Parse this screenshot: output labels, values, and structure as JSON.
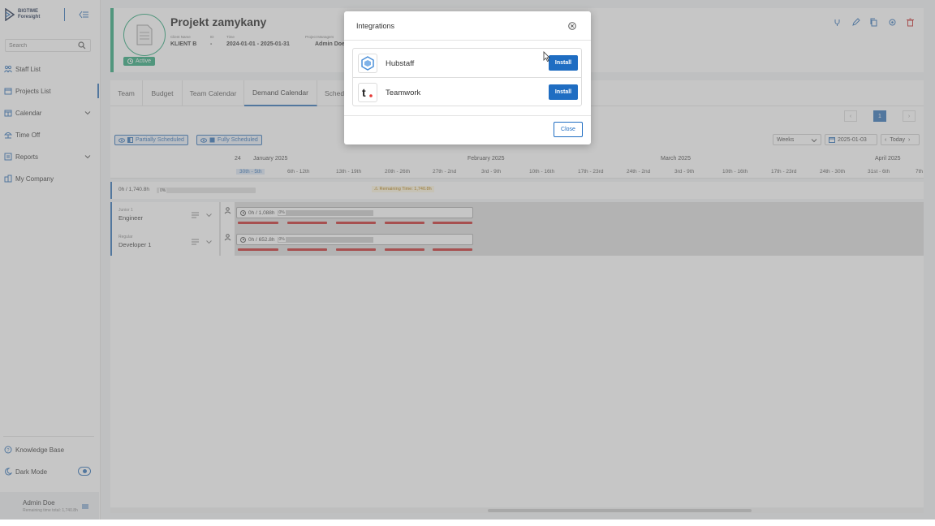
{
  "brand": {
    "line1": "BIGTIME",
    "line2": "Foresight"
  },
  "search": {
    "placeholder": "Search"
  },
  "nav": {
    "staff_list": "Staff List",
    "projects_list": "Projects List",
    "calendar": "Calendar",
    "time_off": "Time Off",
    "reports": "Reports",
    "my_company": "My Company",
    "knowledge_base": "Knowledge Base",
    "dark_mode": "Dark Mode"
  },
  "user": {
    "name": "Admin Doe",
    "subtitle": "Remaining time total: 1,740.8h"
  },
  "project": {
    "title": "Projekt zamykany",
    "status": "Active",
    "client_label": "Client Name",
    "client_value": "KLIENT B",
    "id_label": "ID",
    "id_value": "-",
    "time_label": "Time",
    "time_value": "2024-01-01 - 2025-01-31",
    "manager_label": "Project Managers",
    "manager_value": "Admin Doe"
  },
  "tabs": [
    "Team",
    "Budget",
    "Team Calendar",
    "Demand Calendar",
    "Sched"
  ],
  "pager": {
    "prev": "‹",
    "page": "1",
    "next": "›"
  },
  "filters": {
    "partially": "Partially Scheduled",
    "fully": "Fully Scheduled"
  },
  "controls": {
    "period": "Weeks",
    "date": "2025-01-03",
    "today": "Today"
  },
  "timeline": {
    "months": [
      "24",
      "January 2025",
      "February 2025",
      "March 2025",
      "April 2025"
    ],
    "weeks": [
      "30th - 5th",
      "6th - 12th",
      "13th - 19th",
      "20th - 26th",
      "27th - 2nd",
      "3rd - 9th",
      "10th - 16th",
      "17th - 23rd",
      "24th - 2nd",
      "3rd - 9th",
      "10th - 16th",
      "17th - 23rd",
      "24th - 30th",
      "31st - 6th",
      "7th"
    ]
  },
  "summary": {
    "hours": "0h / 1,740.8h",
    "pct": "0%",
    "warning": "Remaining Time: 1,740.8h"
  },
  "roles": [
    {
      "level": "Junior 1",
      "name": "Engineer",
      "alloc": "0h / 1,088h",
      "pct": "0%"
    },
    {
      "level": "Regular",
      "name": "Developer 1",
      "alloc": "0h / 652.8h",
      "pct": "0%"
    }
  ],
  "modal": {
    "title": "Integrations",
    "items": [
      {
        "name": "Hubstaff",
        "button": "Install"
      },
      {
        "name": "Teamwork",
        "button": "Install"
      }
    ],
    "close_label": "Close"
  },
  "colors": {
    "accent": "#2d6fb7",
    "active": "#2aa87a",
    "danger": "#c62828",
    "button": "#1f6dc2"
  }
}
